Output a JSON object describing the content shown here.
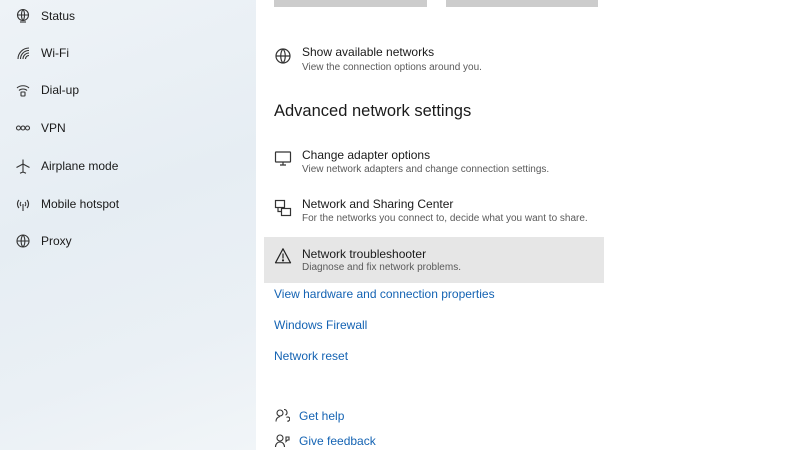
{
  "sidebar": {
    "items": [
      {
        "label": "Status",
        "icon": "status-icon"
      },
      {
        "label": "Wi-Fi",
        "icon": "wifi-icon"
      },
      {
        "label": "Dial-up",
        "icon": "dialup-icon"
      },
      {
        "label": "VPN",
        "icon": "vpn-icon"
      },
      {
        "label": "Airplane mode",
        "icon": "airplane-icon"
      },
      {
        "label": "Mobile hotspot",
        "icon": "hotspot-icon"
      },
      {
        "label": "Proxy",
        "icon": "globe-icon"
      }
    ]
  },
  "main": {
    "show_networks": {
      "title": "Show available networks",
      "desc": "View the connection options around you.",
      "icon": "globe-icon"
    },
    "advanced_heading": "Advanced network settings",
    "adapter": {
      "title": "Change adapter options",
      "desc": "View network adapters and change connection settings.",
      "icon": "monitor-icon"
    },
    "sharing_center": {
      "title": "Network and Sharing Center",
      "desc": "For the networks you connect to, decide what you want to share.",
      "icon": "network-sharing-icon"
    },
    "troubleshooter": {
      "title": "Network troubleshooter",
      "desc": "Diagnose and fix network problems.",
      "icon": "warning-icon",
      "highlighted": true
    },
    "links": {
      "hardware": "View hardware and connection properties",
      "firewall": "Windows Firewall",
      "reset": "Network reset"
    },
    "help": {
      "get_help": "Get help",
      "give_feedback": "Give feedback"
    }
  },
  "colors": {
    "link": "#1463b3",
    "highlight": "#e6e6e6",
    "sidebar_bg": "#eaf0f5"
  }
}
